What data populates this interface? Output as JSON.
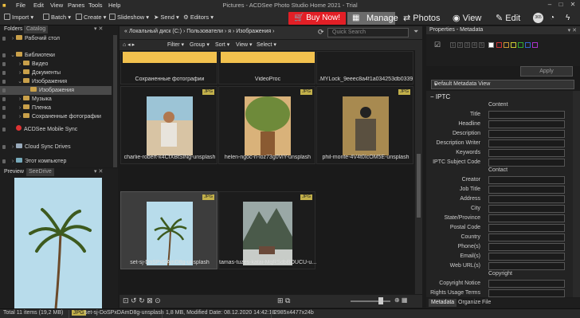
{
  "menubar": {
    "items": [
      "File",
      "Edit",
      "View",
      "Panes",
      "Tools",
      "Help"
    ],
    "title": "Pictures - ACDSee Photo Studio Home 2021 - Trial"
  },
  "toolbar": {
    "import": "Import",
    "batch": "Batch",
    "create": "Create",
    "slideshow": "Slideshow",
    "send": "Send",
    "editors": "Editors",
    "buy_now": "Buy Now!",
    "manage": "Manage",
    "photos": "Photos",
    "view": "View",
    "edit": "Edit",
    "badge": "365"
  },
  "left_panel": {
    "tabs": [
      "Folders",
      "Catalog"
    ],
    "tree": [
      {
        "label": "Рабочий стол",
        "indent": 0,
        "arrow": "›"
      },
      {
        "label": "Библиотеки",
        "indent": 0,
        "arrow": "⌄"
      },
      {
        "label": "Видео",
        "indent": 1,
        "arrow": "›"
      },
      {
        "label": "Документы",
        "indent": 1,
        "arrow": "›"
      },
      {
        "label": "Изображения",
        "indent": 1,
        "arrow": "⌄"
      },
      {
        "label": "Изображения",
        "indent": 2,
        "arrow": ""
      },
      {
        "label": "Музыка",
        "indent": 1,
        "arrow": "›"
      },
      {
        "label": "Пленка",
        "indent": 1,
        "arrow": "›"
      },
      {
        "label": "Сохраненные фотографии",
        "indent": 1,
        "arrow": "›"
      },
      {
        "label": "ACDSee Mobile Sync",
        "indent": 0,
        "arrow": ""
      },
      {
        "label": "Cloud Sync Drives",
        "indent": 0,
        "arrow": "›"
      },
      {
        "label": "Этот компьютер",
        "indent": 0,
        "arrow": "›"
      }
    ],
    "preview_tabs": [
      "Preview",
      "SeeDrive"
    ]
  },
  "center": {
    "breadcrumb": [
      "«",
      "Локальный диск (C:)",
      "›",
      "Пользователи",
      "›",
      "я",
      "›",
      "Изображения",
      "›"
    ],
    "search_placeholder": "Quick Search",
    "filter_bar": [
      "Filter",
      "Group",
      "Sort",
      "View",
      "Select"
    ],
    "folders": [
      "Сохраненные фотографии",
      "VideoProc",
      ".MYLock_9eeec8a4f1a034253db03394d..."
    ],
    "thumbs": [
      {
        "name": "charlie-robert-k4CfXBtSlNg-unsplash",
        "badge": "JPG"
      },
      {
        "name": "helen-ngoc-n-ioz73g0ViY-unsplash",
        "badge": "JPG"
      },
      {
        "name": "phil-monte-4V4t0IcOM5E-unsplash",
        "badge": "JPG"
      },
      {
        "name": "set-sj-DoSPxDAmD8g-unsplash",
        "badge": "JPG"
      },
      {
        "name": "tamas-tuzes-katai-MqRSdbBOUCU-u...",
        "badge": "JPG"
      }
    ]
  },
  "right_panel": {
    "title": "Properties - Metadata",
    "ratings": [
      "1",
      "2",
      "3",
      "4",
      "5"
    ],
    "apply": "Apply",
    "metadata_view": "Default Metadata View",
    "iptc": "IPTC",
    "content_header": "Content",
    "content_fields": [
      "Title",
      "Headline",
      "Description",
      "Description Writer",
      "Keywords",
      "IPTC Subject Code"
    ],
    "contact_header": "Contact",
    "contact_fields": [
      "Creator",
      "Job Title",
      "Address",
      "City",
      "State/Province",
      "Postal Code",
      "Country",
      "Phone(s)",
      "Email(s)",
      "Web URL(s)"
    ],
    "copyright_header": "Copyright",
    "copyright_fields": [
      "Copyright Notice",
      "Rights Usage Terms"
    ],
    "tabs": [
      "Metadata",
      "Organize",
      "File"
    ]
  },
  "statusbar": {
    "total": "Total 11 items  (19,2 MB)",
    "badge": "JPG",
    "filename": "set-sj-DoSPxDAmD8g-unsplash",
    "info": "1,8 MB, Modified Date: 08.12.2020 14:42:18",
    "dims": "2985x4477x24b"
  },
  "colors": {
    "accent_red": "#e21f26",
    "label_yellow": "#c2b04a",
    "folder": "#f2c14e"
  }
}
